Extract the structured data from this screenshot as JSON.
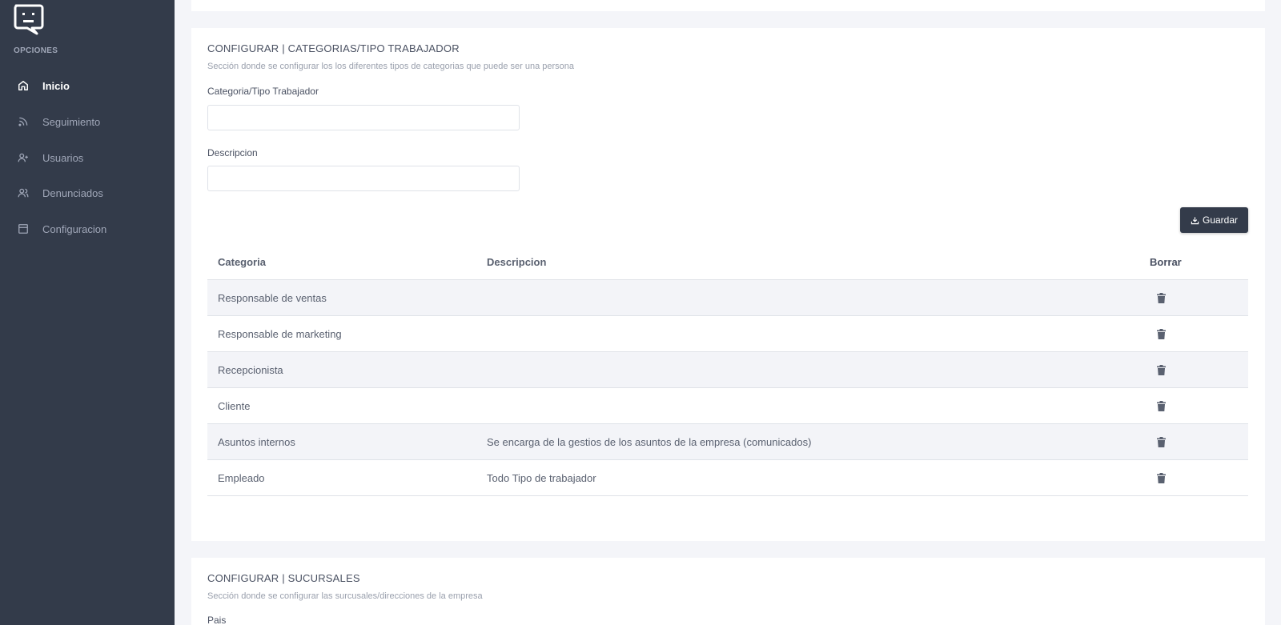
{
  "sidebar": {
    "heading": "OPCIONES",
    "items": [
      {
        "label": "Inicio",
        "icon": "home-icon",
        "active": true
      },
      {
        "label": "Seguimiento",
        "icon": "rss-icon",
        "active": false
      },
      {
        "label": "Usuarios",
        "icon": "user-add-icon",
        "active": false
      },
      {
        "label": "Denunciados",
        "icon": "users-icon",
        "active": false
      },
      {
        "label": "Configuracion",
        "icon": "layout-icon",
        "active": false
      }
    ]
  },
  "categories_section": {
    "title": "CONFIGURAR | CATEGORIAS/TIPO TRABAJADOR",
    "subtitle": "Sección donde se configurar los los diferentes tipos de categorias que puede ser una persona",
    "field1_label": "Categoria/Tipo Trabajador",
    "field1_value": "",
    "field2_label": "Descripcion",
    "field2_value": "",
    "save_label": "Guardar",
    "table": {
      "headers": [
        "Categoria",
        "Descripcion",
        "Borrar"
      ],
      "rows": [
        {
          "categoria": "Responsable de ventas",
          "descripcion": ""
        },
        {
          "categoria": "Responsable de marketing",
          "descripcion": ""
        },
        {
          "categoria": "Recepcionista",
          "descripcion": ""
        },
        {
          "categoria": "Cliente",
          "descripcion": ""
        },
        {
          "categoria": "Asuntos internos",
          "descripcion": "Se encarga de la gestios de los asuntos de la empresa (comunicados)"
        },
        {
          "categoria": "Empleado",
          "descripcion": "Todo Tipo de trabajador"
        }
      ]
    }
  },
  "branches_section": {
    "title": "CONFIGURAR | SUCURSALES",
    "subtitle": "Sección donde se configurar las surcusales/direcciones de la empresa",
    "field1_label": "Pais"
  },
  "colors": {
    "sidebar_bg": "#333b4a",
    "page_bg": "#f4f5f9",
    "button_bg": "#333b4a"
  }
}
